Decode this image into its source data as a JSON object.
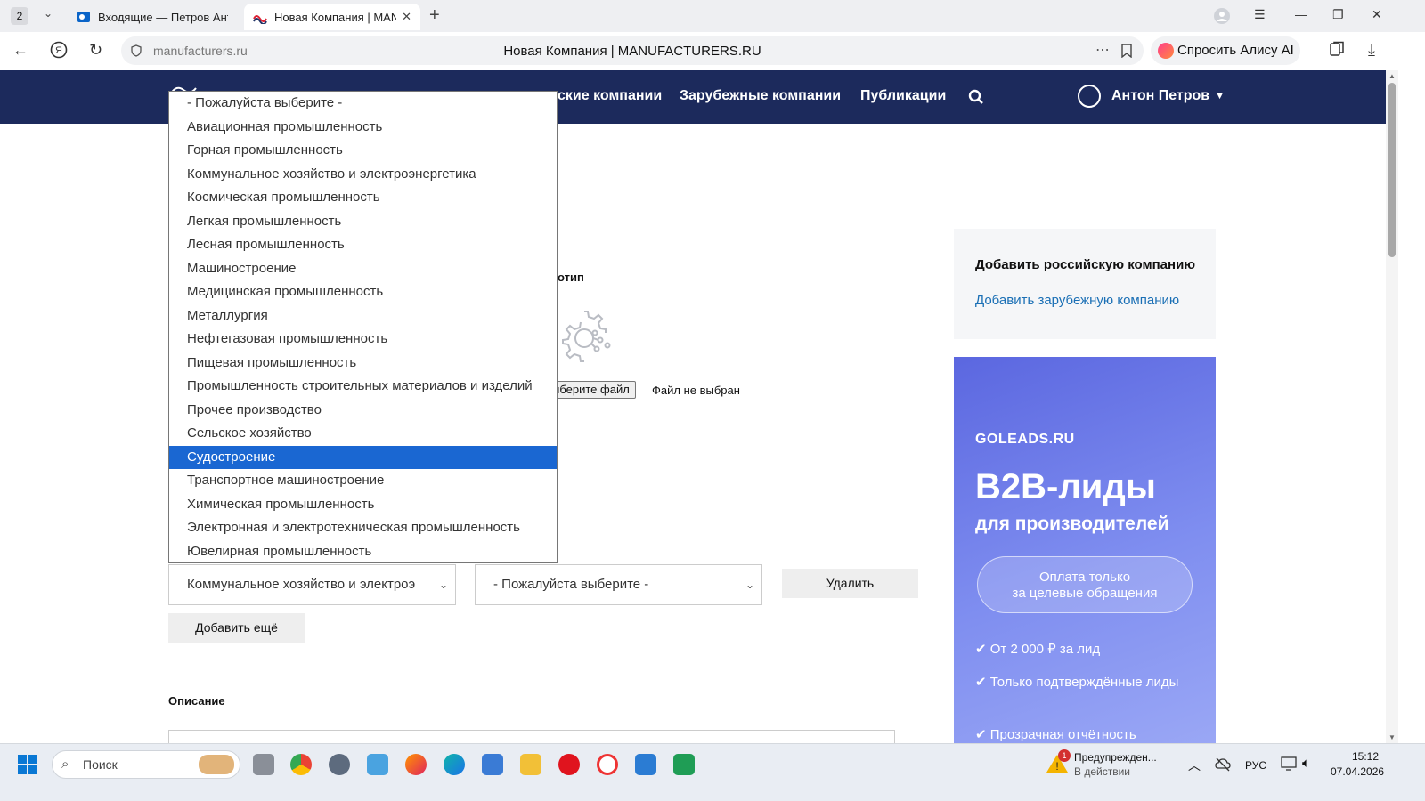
{
  "browser": {
    "tab_count": "2",
    "tabs": [
      {
        "title": "Входящие — Петров Анто"
      },
      {
        "title": "Новая Компания | MAN"
      }
    ],
    "url": "manufacturers.ru",
    "page_title": "Новая Компания | MANUFACTURERS.RU",
    "alisa_button": "Спросить Алису AI"
  },
  "site_nav": {
    "items": [
      "ские компании",
      "Зарубежные компании",
      "Публикации"
    ],
    "user_name": "Антон Петров"
  },
  "form": {
    "logo_label": "отип",
    "file_button": "ыберите файл",
    "file_status": "Файл не выбран",
    "industry_select_value": "Коммунальное хозяйство и электроэ",
    "subindustry_select_value": "- Пожалуйста выберите -",
    "delete_button": "Удалить",
    "add_more_button": "Добавить ещё",
    "description_label": "Описание"
  },
  "dropdown": {
    "selected_index": 16,
    "options": [
      "- Пожалуйста выберите -",
      "Авиационная промышленность",
      "Горная промышленность",
      "Коммунальное хозяйство и электроэнергетика",
      "Космическая промышленность",
      "Легкая промышленность",
      "Лесная промышленность",
      "Машиностроение",
      "Медицинская промышленность",
      "Металлургия",
      "Нефтегазовая промышленность",
      "Пищевая промышленность",
      "Промышленность строительных материалов и изделий",
      "Прочее производство",
      "Сельское хозяйство",
      "Судостроение",
      "Транспортное машиностроение",
      "Химическая промышленность",
      "Электронная и электротехническая промышленность",
      "Ювелирная промышленность"
    ]
  },
  "sidebar": {
    "add_russian": "Добавить российскую компанию",
    "add_foreign": "Добавить зарубежную компанию"
  },
  "ad": {
    "brand": "GOLEADS.RU",
    "headline": "B2B-лиды",
    "subheadline": "для производителей",
    "pill_line1": "Оплата только",
    "pill_line2": "за целевые обращения",
    "bullets": [
      "✔ От 2 000 ₽ за лид",
      "✔ Только подтверждённые лиды",
      "✔ Прозрачная отчётность"
    ]
  },
  "taskbar": {
    "search_placeholder": "Поиск",
    "notification_title": "Предупрежден...",
    "notification_sub": "В действии",
    "notification_badge": "1",
    "language": "РУС",
    "time": "15:12",
    "date": "07.04.2026"
  },
  "colors": {
    "header_bg": "#1c2a5c",
    "selected_option": "#1a67d2",
    "link": "#1a6fb5",
    "ad_gradient_start": "#5b67e0"
  }
}
